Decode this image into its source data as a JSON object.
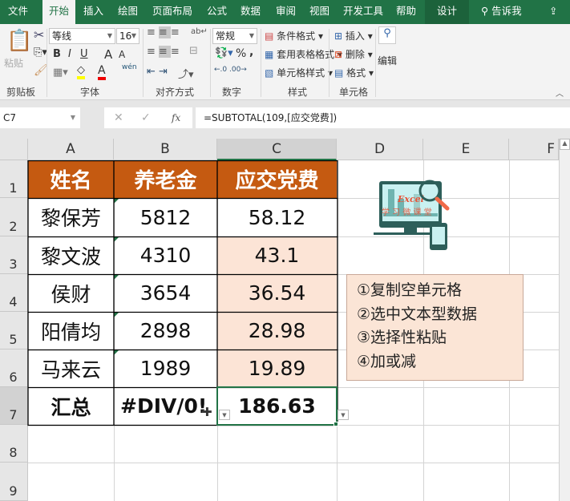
{
  "tabs": [
    "文件",
    "开始",
    "插入",
    "绘图",
    "页面布局",
    "公式",
    "数据",
    "审阅",
    "视图",
    "开发工具",
    "帮助",
    "设计"
  ],
  "tell_me": "告诉我",
  "ribbon": {
    "clipboard": {
      "paste": "粘贴",
      "label": "剪贴板"
    },
    "font": {
      "name": "等线",
      "size": "16",
      "bold": "B",
      "italic": "I",
      "underline": "U",
      "grow": "A",
      "shrink": "A",
      "color": "A",
      "phonetic": "wén",
      "label": "字体"
    },
    "alignment": {
      "label": "对齐方式"
    },
    "number": {
      "format": "常规",
      "percent": "%",
      "comma": ",",
      "label": "数字"
    },
    "styles": {
      "conditional": "条件格式",
      "table": "套用表格格式",
      "cell": "单元格样式",
      "label": "样式"
    },
    "cells": {
      "insert": "插入",
      "delete": "删除",
      "format": "格式",
      "label": "单元格"
    },
    "editing": {
      "label": "编辑"
    }
  },
  "formula_bar": {
    "name_box": "C7",
    "fx": "fx",
    "formula": "=SUBTOTAL(109,[应交党费])"
  },
  "columns": [
    "A",
    "B",
    "C",
    "D",
    "E",
    "F"
  ],
  "rows": [
    "1",
    "2",
    "3",
    "4",
    "5",
    "6",
    "7",
    "8",
    "9"
  ],
  "table": {
    "headers": [
      "姓名",
      "养老金",
      "应交党费"
    ],
    "rows": [
      [
        "黎保芳",
        "5812",
        "58.12"
      ],
      [
        "黎文波",
        "4310",
        "43.1"
      ],
      [
        "侯财",
        "3654",
        "36.54"
      ],
      [
        "阳倩均",
        "2898",
        "28.98"
      ],
      [
        "马来云",
        "1989",
        "19.89"
      ]
    ],
    "total": [
      "汇总",
      "#DIV/0!",
      "186.63"
    ]
  },
  "note": [
    "①复制空单元格",
    "②选中文本型数据",
    "③选择性粘贴",
    "④加或减"
  ],
  "logo": {
    "text1": "Excel",
    "text2": "学习微课堂"
  },
  "colors": {
    "green": "#217346",
    "header": "#c55a11",
    "pink": "#fce4d6"
  }
}
